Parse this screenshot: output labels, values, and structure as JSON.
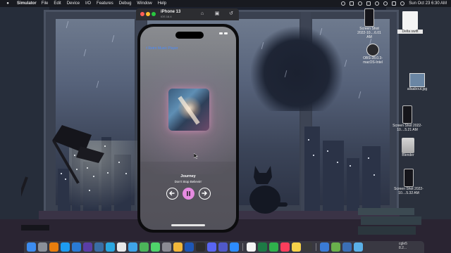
{
  "menubar": {
    "app_name": "Simulator",
    "items": [
      "File",
      "Edit",
      "Device",
      "I/O",
      "Features",
      "Debug",
      "Window",
      "Help"
    ],
    "clock": "Sun Oct 23  6:30 AM"
  },
  "simulator": {
    "device_title": "iPhone 13",
    "os_version": "iOS 16.4",
    "traffic_light_colors": [
      "#ff5f57",
      "#febc2e",
      "#28c840"
    ]
  },
  "phone": {
    "time": "",
    "nav_back_label": "Retro Music Player",
    "now_playing": {
      "artist": "Journey",
      "song": "Don't Stop Believin'"
    },
    "controls": {
      "previous_icon": "arrow-left-icon",
      "play_pause_icon": "pause-icon",
      "next_icon": "arrow-right-icon"
    },
    "accent_color": "#e58be0"
  },
  "desktop_icons": [
    {
      "label": "Screen Shot 2022-10....6.01 AM",
      "type": "screenshot"
    },
    {
      "label": "OBS-28.0.3-macOS-Intel",
      "type": "app"
    },
    {
      "label": "Delta swift",
      "type": "document"
    },
    {
      "label": "allaabout.jpg",
      "type": "image"
    },
    {
      "label": "Screen Shot 2022-10....5.21 AM",
      "type": "screenshot"
    },
    {
      "label": "Blender",
      "type": "disk"
    },
    {
      "label": "Screen Shot 2022-10....5.32 AM",
      "type": "screenshot"
    }
  ],
  "dock": {
    "apps": [
      {
        "name": "finder-icon",
        "color": "#3c8cf0"
      },
      {
        "name": "launchpad-icon",
        "color": "#8a8f99"
      },
      {
        "name": "blender-icon",
        "color": "#e87d0d"
      },
      {
        "name": "safari-icon",
        "color": "#1d9bf0"
      },
      {
        "name": "vscode-icon",
        "color": "#2a7bd5"
      },
      {
        "name": "github-icon",
        "color": "#5a3ea6"
      },
      {
        "name": "xcode-icon",
        "color": "#3a6ea5"
      },
      {
        "name": "docker-icon",
        "color": "#2aa7e0"
      },
      {
        "name": "chrome-icon",
        "color": "#e9e9e9"
      },
      {
        "name": "chrome-dev-icon",
        "color": "#3fa4e8"
      },
      {
        "name": "spotlight-icon",
        "color": "#4cb55a"
      },
      {
        "name": "messages-icon",
        "color": "#4fd36b"
      },
      {
        "name": "system-prefs-icon",
        "color": "#8b8b93"
      },
      {
        "name": "photos-icon",
        "color": "#f2b73a"
      },
      {
        "name": "bitwarden-icon",
        "color": "#1e57b6"
      },
      {
        "name": "terminal-icon",
        "color": "#2c2c2c"
      },
      {
        "name": "discord-icon",
        "color": "#5865f2"
      },
      {
        "name": "teams-icon",
        "color": "#5059c9"
      },
      {
        "name": "zoom-icon",
        "color": "#2d8cff"
      },
      {
        "name": "calendar-icon",
        "color": "#f4f4f4"
      },
      {
        "name": "excel-icon",
        "color": "#1d7a45"
      },
      {
        "name": "numbers-icon",
        "color": "#2fb24c"
      },
      {
        "name": "music-icon",
        "color": "#fa3e5c"
      },
      {
        "name": "notes-icon",
        "color": "#f6d34a"
      },
      {
        "name": "obs-icon",
        "color": "#3a3a3a"
      },
      {
        "name": "simulator-icon",
        "color": "#3a7bd5"
      },
      {
        "name": "preview-icon",
        "color": "#6ab04c"
      },
      {
        "name": "xcode-2-icon",
        "color": "#3b6fb5"
      },
      {
        "name": "folder-icon",
        "color": "#5ab0e8"
      }
    ],
    "trailing_label": "cgle5\n8.2..."
  }
}
